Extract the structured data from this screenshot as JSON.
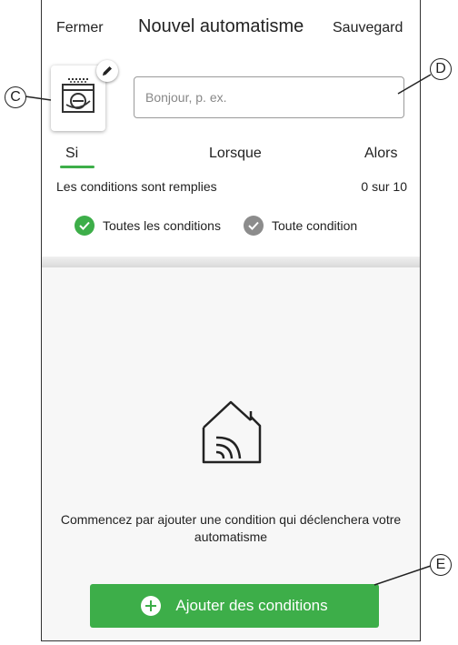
{
  "header": {
    "close_label": "Fermer",
    "title": "Nouvel automatisme",
    "save_label": "Sauvegard"
  },
  "automation_icon": {
    "icon": "dishwasher-icon",
    "edit_icon": "pencil-icon"
  },
  "name_input": {
    "placeholder": "Bonjour, p. ex.",
    "value": ""
  },
  "tabs": [
    {
      "label": "Si",
      "active": true
    },
    {
      "label": "Lorsque",
      "active": false
    },
    {
      "label": "Alors",
      "active": false
    }
  ],
  "conditions": {
    "label": "Les conditions sont remplies",
    "count": "0 sur 10",
    "options": [
      {
        "label": "Toutes les conditions",
        "selected": true,
        "color": "#3dae49"
      },
      {
        "label": "Toute condition",
        "selected": false,
        "color": "#8c8c8c"
      }
    ]
  },
  "empty_state": {
    "icon": "smart-home-icon",
    "message": "Commencez par ajouter une condition qui déclenchera votre automatisme"
  },
  "add_button": {
    "label": "Ajouter des conditions",
    "icon": "plus-circle-icon"
  },
  "callouts": {
    "c": "C",
    "d": "D",
    "e": "E"
  },
  "colors": {
    "accent": "#3dae49",
    "inactive": "#8c8c8c"
  }
}
